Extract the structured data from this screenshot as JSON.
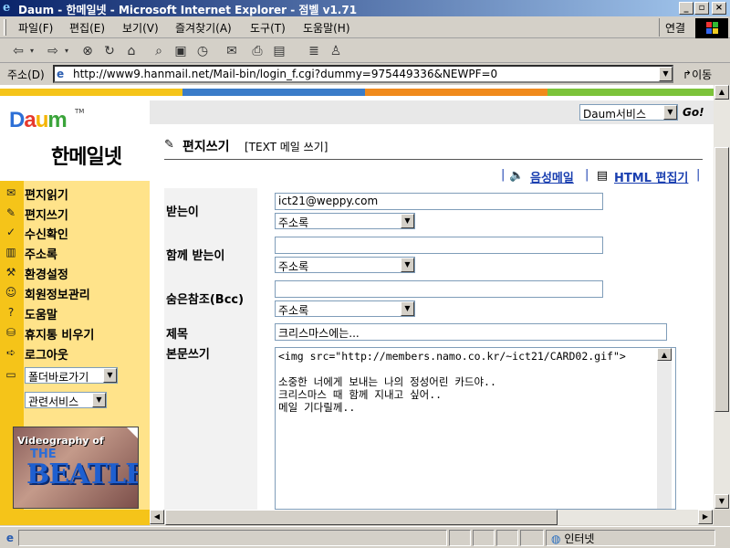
{
  "window": {
    "title": "Daum - 한메일넷 - Microsoft Internet Explorer - 점벨 v1.71"
  },
  "menubar": {
    "items": [
      "파일(F)",
      "편집(E)",
      "보기(V)",
      "즐겨찾기(A)",
      "도구(T)",
      "도움말(H)"
    ],
    "connect": "연결"
  },
  "addressbar": {
    "label": "주소(D)",
    "url": "http://www9.hanmail.net/Mail-bin/login_f.cgi?dummy=975449336&NEWPF=0",
    "go": "이동"
  },
  "sidebar": {
    "logo_daum": "Daum",
    "logo_tm": "TM",
    "logo_hanmail": "한메일넷",
    "nav": [
      {
        "label": "편지읽기",
        "icon": "read-mail-icon"
      },
      {
        "label": "편지쓰기",
        "icon": "write-mail-icon"
      },
      {
        "label": "수신확인",
        "icon": "receipt-check-icon"
      },
      {
        "label": "주소록",
        "icon": "address-book-icon"
      },
      {
        "label": "환경설정",
        "icon": "settings-icon"
      },
      {
        "label": "회원정보관리",
        "icon": "member-info-icon"
      },
      {
        "label": "도움말",
        "icon": "help-icon"
      },
      {
        "label": "휴지통 비우기",
        "icon": "trash-icon"
      },
      {
        "label": "로그아웃",
        "icon": "logout-icon"
      }
    ],
    "folder_select": "폴더바로가기",
    "related_select": "관련서비스",
    "banner": {
      "line1": "Videography of",
      "line2": "THE",
      "line3": "BEATLES"
    }
  },
  "content": {
    "service_select": "Daum서비스",
    "go_button": "Go!",
    "page_title": "편지쓰기",
    "page_subtitle": "[TEXT 메일 쓰기]",
    "tools": {
      "voice_mail": "음성메일",
      "html_editor": "HTML 편집기",
      "sep": "|"
    },
    "form": {
      "to_label": "받는이",
      "to_value": "ict21@weppy.com",
      "cc_label": "함께 받는이",
      "cc_value": "",
      "bcc_label": "숨은참조(Bcc)",
      "bcc_value": "",
      "addressbook_option": "주소록",
      "subject_label": "제목",
      "subject_value": "크리스마스에는...",
      "body_label": "본문쓰기",
      "body_value": "<img src=\"http://members.namo.co.kr/~ict21/CARD02.gif\">\n\n소중한 너에게 보내는 나의 정성어린 카드야..\n크리스마스 때 함께 지내고 싶어..\n메일 기다릴께.."
    }
  },
  "statusbar": {
    "zone": "인터넷"
  },
  "colors": {
    "titlebar_start": "#0a246a",
    "sidebar_yellow": "#ffe38a",
    "sidebar_strip": "#f5c419",
    "link_blue": "#1a3fb0",
    "daum_strip": [
      "#f5c419",
      "#3a7cc9",
      "#f08a1c",
      "#7cc33a"
    ]
  }
}
